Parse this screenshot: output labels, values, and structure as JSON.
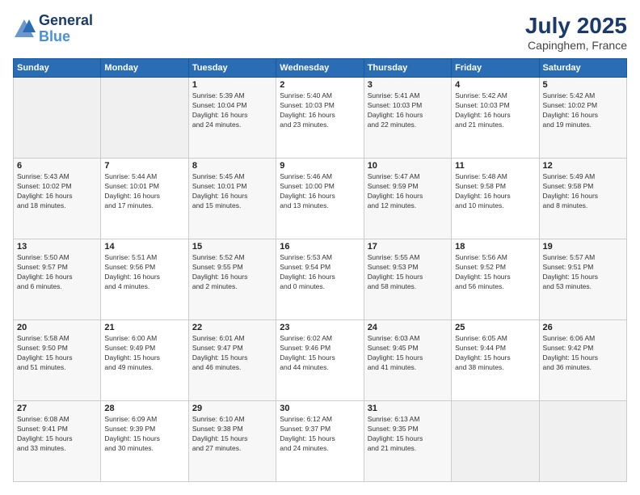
{
  "logo": {
    "line1": "General",
    "line2": "Blue"
  },
  "title": "July 2025",
  "location": "Capinghem, France",
  "days_header": [
    "Sunday",
    "Monday",
    "Tuesday",
    "Wednesday",
    "Thursday",
    "Friday",
    "Saturday"
  ],
  "weeks": [
    [
      {
        "day": "",
        "content": ""
      },
      {
        "day": "",
        "content": ""
      },
      {
        "day": "1",
        "content": "Sunrise: 5:39 AM\nSunset: 10:04 PM\nDaylight: 16 hours\nand 24 minutes."
      },
      {
        "day": "2",
        "content": "Sunrise: 5:40 AM\nSunset: 10:03 PM\nDaylight: 16 hours\nand 23 minutes."
      },
      {
        "day": "3",
        "content": "Sunrise: 5:41 AM\nSunset: 10:03 PM\nDaylight: 16 hours\nand 22 minutes."
      },
      {
        "day": "4",
        "content": "Sunrise: 5:42 AM\nSunset: 10:03 PM\nDaylight: 16 hours\nand 21 minutes."
      },
      {
        "day": "5",
        "content": "Sunrise: 5:42 AM\nSunset: 10:02 PM\nDaylight: 16 hours\nand 19 minutes."
      }
    ],
    [
      {
        "day": "6",
        "content": "Sunrise: 5:43 AM\nSunset: 10:02 PM\nDaylight: 16 hours\nand 18 minutes."
      },
      {
        "day": "7",
        "content": "Sunrise: 5:44 AM\nSunset: 10:01 PM\nDaylight: 16 hours\nand 17 minutes."
      },
      {
        "day": "8",
        "content": "Sunrise: 5:45 AM\nSunset: 10:01 PM\nDaylight: 16 hours\nand 15 minutes."
      },
      {
        "day": "9",
        "content": "Sunrise: 5:46 AM\nSunset: 10:00 PM\nDaylight: 16 hours\nand 13 minutes."
      },
      {
        "day": "10",
        "content": "Sunrise: 5:47 AM\nSunset: 9:59 PM\nDaylight: 16 hours\nand 12 minutes."
      },
      {
        "day": "11",
        "content": "Sunrise: 5:48 AM\nSunset: 9:58 PM\nDaylight: 16 hours\nand 10 minutes."
      },
      {
        "day": "12",
        "content": "Sunrise: 5:49 AM\nSunset: 9:58 PM\nDaylight: 16 hours\nand 8 minutes."
      }
    ],
    [
      {
        "day": "13",
        "content": "Sunrise: 5:50 AM\nSunset: 9:57 PM\nDaylight: 16 hours\nand 6 minutes."
      },
      {
        "day": "14",
        "content": "Sunrise: 5:51 AM\nSunset: 9:56 PM\nDaylight: 16 hours\nand 4 minutes."
      },
      {
        "day": "15",
        "content": "Sunrise: 5:52 AM\nSunset: 9:55 PM\nDaylight: 16 hours\nand 2 minutes."
      },
      {
        "day": "16",
        "content": "Sunrise: 5:53 AM\nSunset: 9:54 PM\nDaylight: 16 hours\nand 0 minutes."
      },
      {
        "day": "17",
        "content": "Sunrise: 5:55 AM\nSunset: 9:53 PM\nDaylight: 15 hours\nand 58 minutes."
      },
      {
        "day": "18",
        "content": "Sunrise: 5:56 AM\nSunset: 9:52 PM\nDaylight: 15 hours\nand 56 minutes."
      },
      {
        "day": "19",
        "content": "Sunrise: 5:57 AM\nSunset: 9:51 PM\nDaylight: 15 hours\nand 53 minutes."
      }
    ],
    [
      {
        "day": "20",
        "content": "Sunrise: 5:58 AM\nSunset: 9:50 PM\nDaylight: 15 hours\nand 51 minutes."
      },
      {
        "day": "21",
        "content": "Sunrise: 6:00 AM\nSunset: 9:49 PM\nDaylight: 15 hours\nand 49 minutes."
      },
      {
        "day": "22",
        "content": "Sunrise: 6:01 AM\nSunset: 9:47 PM\nDaylight: 15 hours\nand 46 minutes."
      },
      {
        "day": "23",
        "content": "Sunrise: 6:02 AM\nSunset: 9:46 PM\nDaylight: 15 hours\nand 44 minutes."
      },
      {
        "day": "24",
        "content": "Sunrise: 6:03 AM\nSunset: 9:45 PM\nDaylight: 15 hours\nand 41 minutes."
      },
      {
        "day": "25",
        "content": "Sunrise: 6:05 AM\nSunset: 9:44 PM\nDaylight: 15 hours\nand 38 minutes."
      },
      {
        "day": "26",
        "content": "Sunrise: 6:06 AM\nSunset: 9:42 PM\nDaylight: 15 hours\nand 36 minutes."
      }
    ],
    [
      {
        "day": "27",
        "content": "Sunrise: 6:08 AM\nSunset: 9:41 PM\nDaylight: 15 hours\nand 33 minutes."
      },
      {
        "day": "28",
        "content": "Sunrise: 6:09 AM\nSunset: 9:39 PM\nDaylight: 15 hours\nand 30 minutes."
      },
      {
        "day": "29",
        "content": "Sunrise: 6:10 AM\nSunset: 9:38 PM\nDaylight: 15 hours\nand 27 minutes."
      },
      {
        "day": "30",
        "content": "Sunrise: 6:12 AM\nSunset: 9:37 PM\nDaylight: 15 hours\nand 24 minutes."
      },
      {
        "day": "31",
        "content": "Sunrise: 6:13 AM\nSunset: 9:35 PM\nDaylight: 15 hours\nand 21 minutes."
      },
      {
        "day": "",
        "content": ""
      },
      {
        "day": "",
        "content": ""
      }
    ]
  ]
}
